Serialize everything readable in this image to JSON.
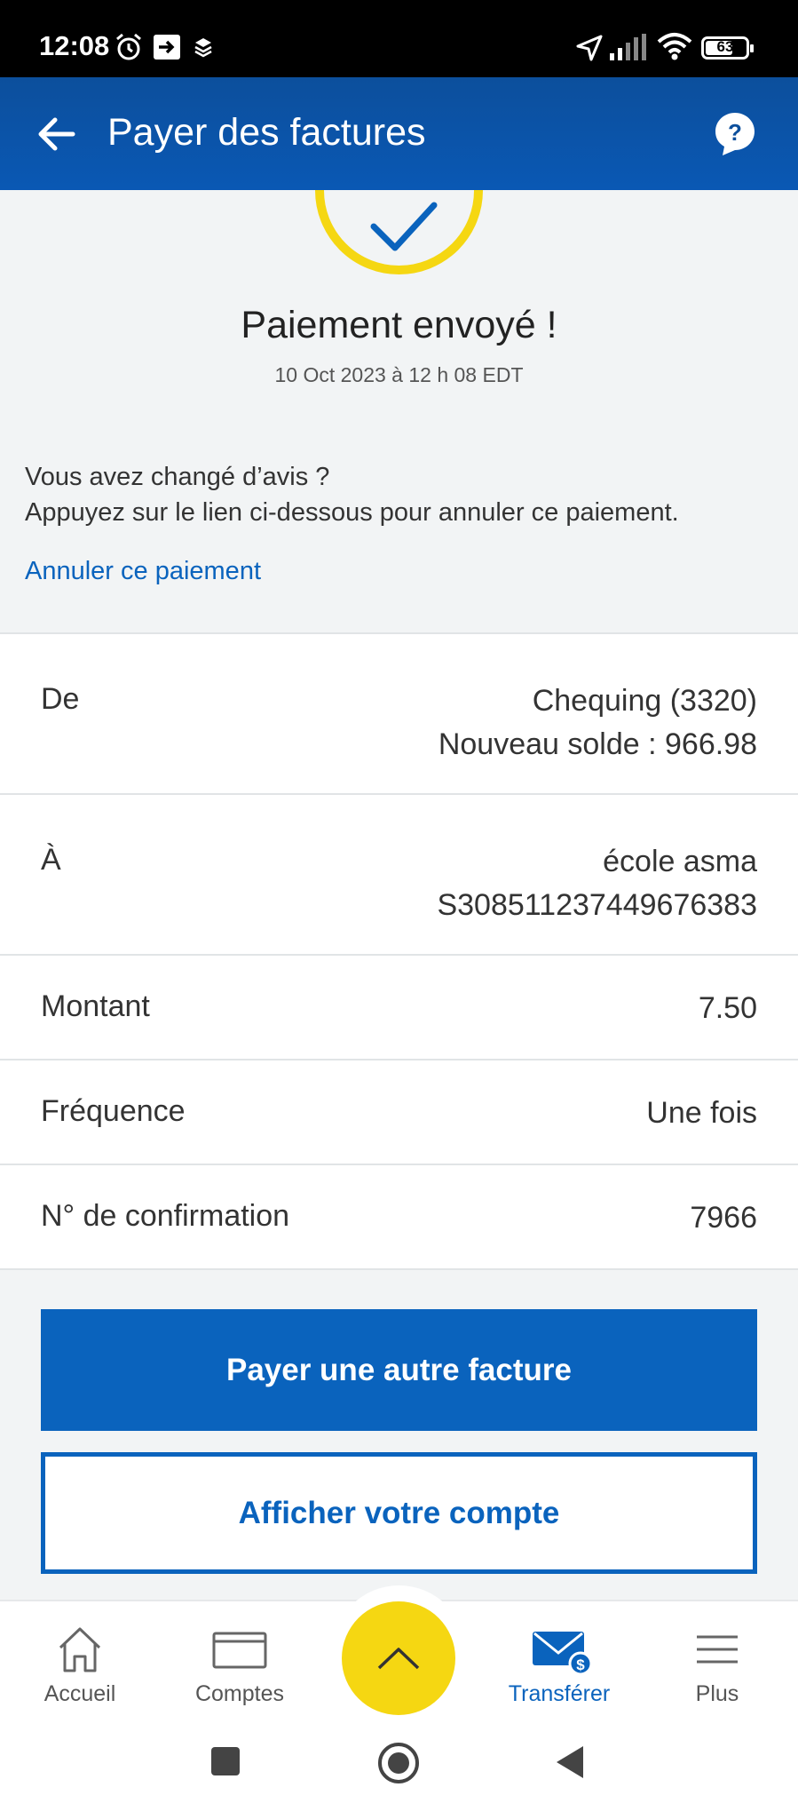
{
  "status_bar": {
    "time": "12:08",
    "battery_level": "63",
    "icons": [
      "alarm-icon",
      "cast-icon",
      "layers-icon",
      "location-arrow-icon",
      "signal-icon",
      "wifi-icon",
      "battery-icon"
    ]
  },
  "app_bar": {
    "title": "Payer des factures",
    "back_icon": "arrow-left-icon",
    "help_icon": "help-chat-icon",
    "background_color": "#0a58b4"
  },
  "confirmation": {
    "title": "Paiement envoyé !",
    "datetime": "10 Oct 2023 à 12 h 08 EDT",
    "changed_mind_line1": "Vous avez changé d’avis ?",
    "changed_mind_line2": "Appuyez sur le lien ci-dessous pour annuler ce paiement.",
    "cancel_link": "Annuler ce paiement",
    "accent_color": "#f5d712"
  },
  "details": {
    "from": {
      "label": "De",
      "account": "Chequing (3320)",
      "balance": "Nouveau solde : 966.98"
    },
    "to": {
      "label": "À",
      "payee": "école asma",
      "reference": "S308511237449676383"
    },
    "amount": {
      "label": "Montant",
      "value": "7.50"
    },
    "frequency": {
      "label": "Fréquence",
      "value": "Une fois"
    },
    "confirmation_number": {
      "label": "N° de confirmation",
      "value": "7966"
    }
  },
  "actions": {
    "primary": "Payer une autre facture",
    "secondary": "Afficher votre compte",
    "brand_color": "#0a63bd"
  },
  "bottom_nav": {
    "items": [
      {
        "label": "Accueil",
        "icon": "home-icon"
      },
      {
        "label": "Comptes",
        "icon": "card-icon"
      },
      {
        "label": "Transférer",
        "icon": "envelope-dollar-icon",
        "active": true
      },
      {
        "label": "Plus",
        "icon": "menu-icon"
      }
    ],
    "fab_icon": "chevron-up-icon"
  },
  "system_nav": {
    "icons": [
      "recents-square-icon",
      "home-circle-icon",
      "back-triangle-icon"
    ]
  }
}
